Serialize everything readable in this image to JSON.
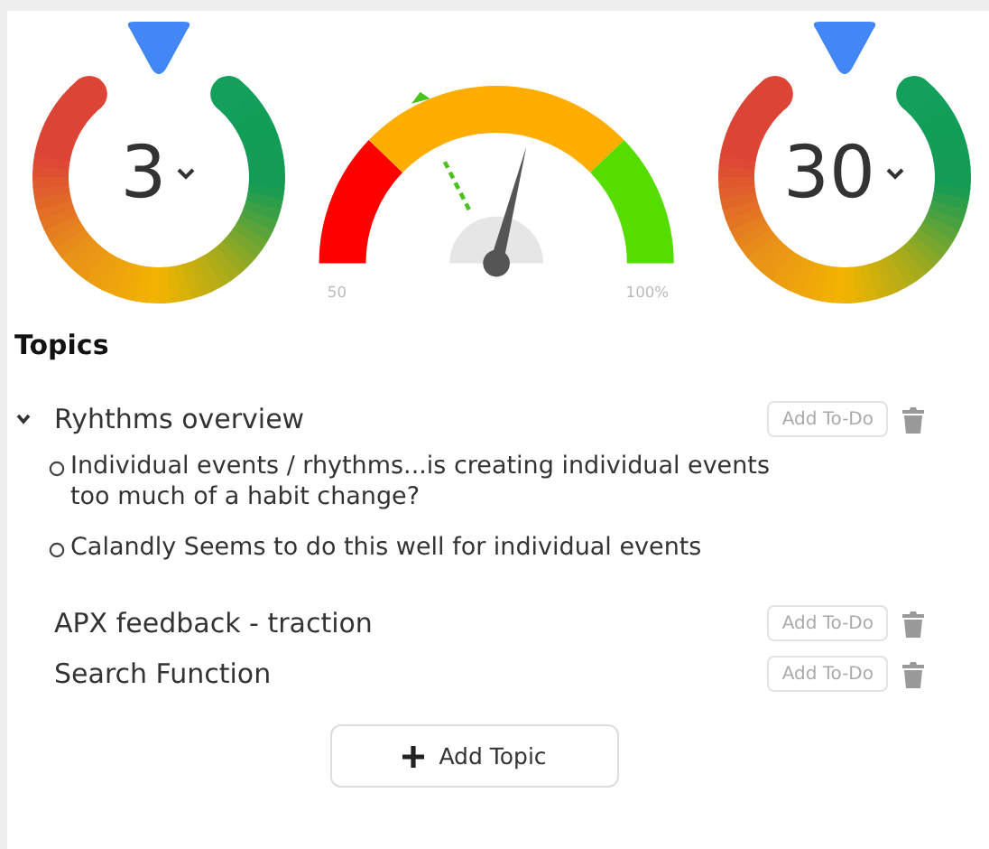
{
  "gauges": [
    {
      "kind": "ring",
      "value": "3"
    },
    {
      "kind": "meter",
      "min_label": "50",
      "max_label": "100%"
    },
    {
      "kind": "ring",
      "value": "30"
    }
  ],
  "topics_section": {
    "title": "Topics",
    "topics": [
      {
        "title": "Ryhthms overview",
        "expanded": true,
        "action": "Add To-Do",
        "notes": [
          "Individual events / rhythms...is creating individual events too much of a habit change?",
          "Calandly Seems to do this well for individual events"
        ]
      },
      {
        "title": "APX feedback - traction",
        "action": "Add To-Do"
      },
      {
        "title": "Search Function",
        "action": "Add To-Do"
      }
    ],
    "add_button": "Add Topic"
  }
}
